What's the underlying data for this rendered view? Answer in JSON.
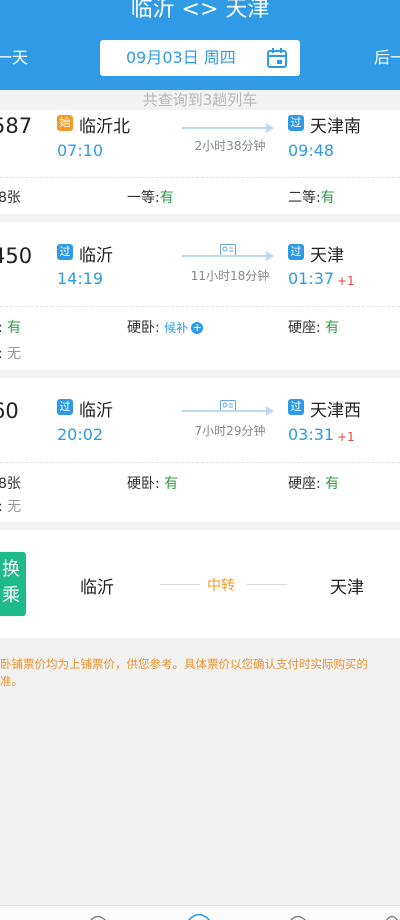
{
  "header": {
    "title": "临沂 <> 天津",
    "prev_day": "一天",
    "next_day": "后一",
    "date": "09月03日 周四",
    "calendar_icon": "calendar-icon",
    "bg_color": "#2f9be6"
  },
  "summary": "共查询到3趟列车",
  "trains": [
    {
      "number": "587",
      "from_badge": "始",
      "from_station": "临沂北",
      "depart": "07:10",
      "duration": "2小时38分钟",
      "to_badge": "过",
      "to_station": "天津南",
      "arrive": "09:48",
      "next_day": "",
      "seats_row1": [
        {
          "label": "",
          "value": "8张"
        },
        {
          "label": "一等:",
          "value": "有"
        },
        {
          "label": "二等:",
          "value": "有"
        }
      ]
    },
    {
      "number": "450",
      "from_badge": "过",
      "from_station": "临沂",
      "depart": "14:19",
      "duration": "11小时18分钟",
      "to_badge": "过",
      "to_station": "天津",
      "arrive": "01:37",
      "next_day": "+1",
      "seats_row1": [
        {
          "label": ":",
          "value": "有"
        },
        {
          "label": "硬卧:",
          "value": "候补"
        },
        {
          "label": "硬座:",
          "value": "有"
        }
      ],
      "seats_row2": [
        {
          "label": ":",
          "value": "无"
        }
      ]
    },
    {
      "number": "60",
      "from_badge": "过",
      "from_station": "临沂",
      "depart": "20:02",
      "duration": "7小时29分钟",
      "to_badge": "过",
      "to_station": "天津西",
      "arrive": "03:31",
      "next_day": "+1",
      "seats_row1": [
        {
          "label": "",
          "value": "8张"
        },
        {
          "label": "硬卧:",
          "value": "有"
        },
        {
          "label": "硬座:",
          "value": "有"
        }
      ],
      "seats_row2": [
        {
          "label": ":",
          "value": "无"
        }
      ]
    }
  ],
  "transfer": {
    "badge": "换乘",
    "badge_line1": "换",
    "badge_line2": "乘",
    "from": "临沂",
    "middle": "中转",
    "to": "天津"
  },
  "notice": {
    "line1": "卧铺票价均为上铺票价，供您参考。具体票价以您确认支付时实际购买的",
    "line2": "准。"
  }
}
